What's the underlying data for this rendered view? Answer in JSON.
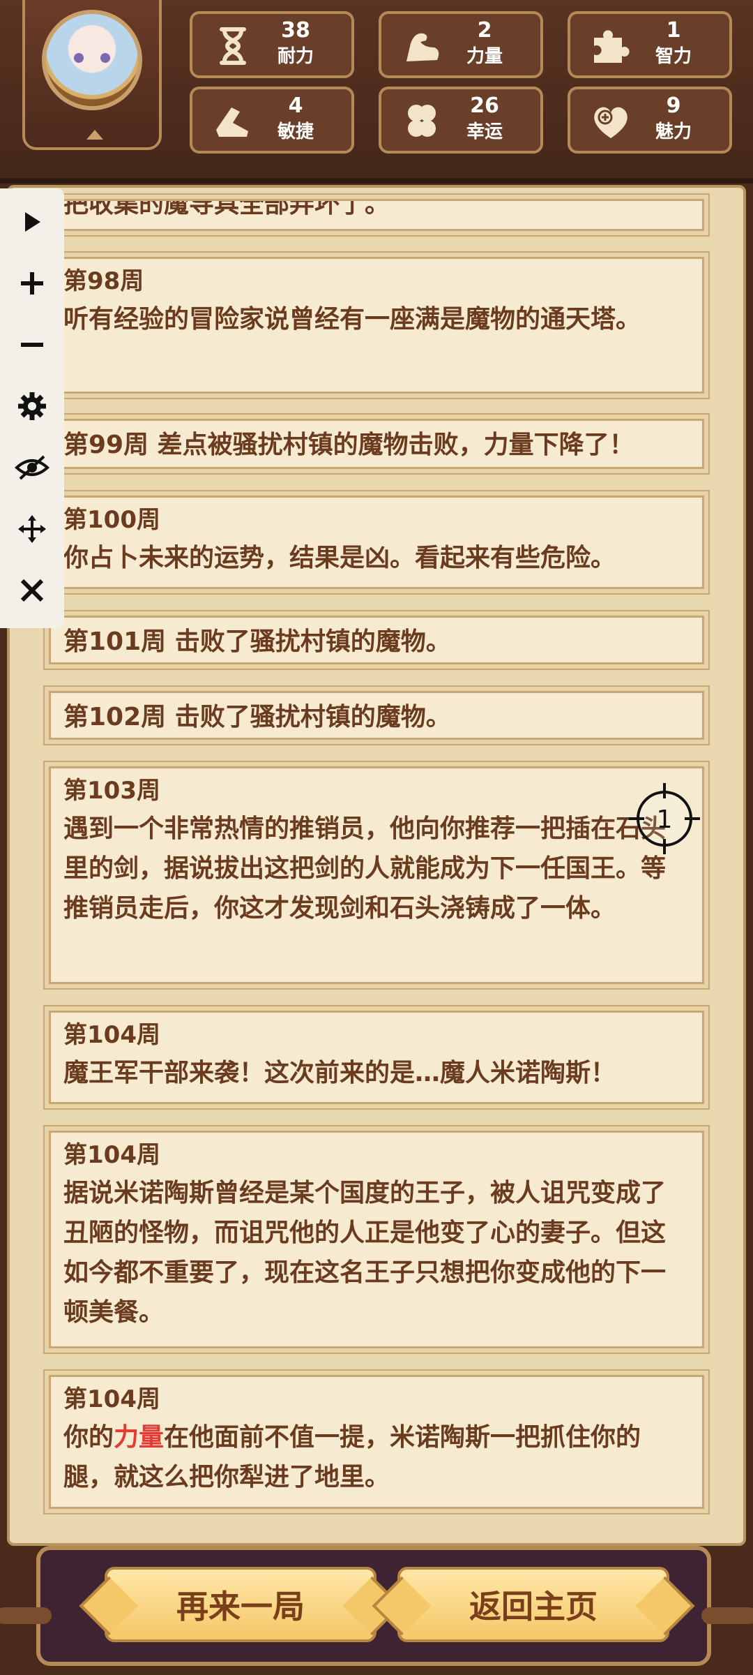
{
  "stats": [
    {
      "icon": "hourglass-icon",
      "value": "38",
      "label": "耐力"
    },
    {
      "icon": "muscle-arm-icon",
      "value": "2",
      "label": "力量"
    },
    {
      "icon": "puzzle-piece-icon",
      "value": "1",
      "label": "智力"
    },
    {
      "icon": "boot-icon",
      "value": "4",
      "label": "敏捷"
    },
    {
      "icon": "clover-icon",
      "value": "26",
      "label": "幸运"
    },
    {
      "icon": "heart-plus-icon",
      "value": "9",
      "label": "魅力"
    }
  ],
  "events": [
    {
      "text": "把收集的魔导具全部弄坏了。"
    },
    {
      "week": "第98周",
      "text": "听有经验的冒险家说曾经有一座满是魔物的通天塔。"
    },
    {
      "week": "第99周",
      "text": "差点被骚扰村镇的魔物击败，力量下降了！"
    },
    {
      "week": "第100周",
      "text": "你占卜未来的运势，结果是凶。看起来有些危险。"
    },
    {
      "week": "第101周",
      "text": "击败了骚扰村镇的魔物。"
    },
    {
      "week": "第102周",
      "text": "击败了骚扰村镇的魔物。"
    },
    {
      "week": "第103周",
      "text": "遇到一个非常热情的推销员，他向你推荐一把插在石头里的剑，据说拔出这把剑的人就能成为下一任国王。等推销员走后，你这才发现剑和石头浇铸成了一体。"
    },
    {
      "week": "第104周",
      "text": "魔王军干部来袭！这次前来的是…魔人米诺陶斯！"
    },
    {
      "week": "第104周",
      "text": "据说米诺陶斯曾经是某个国度的王子，被人诅咒变成了丑陋的怪物，而诅咒他的人正是他变了心的妻子。但这如今都不重要了，现在这名王子只想把你变成他的下一顿美餐。"
    },
    {
      "week": "第104周",
      "text_before": "你的",
      "highlight": "力量",
      "text_after": "在他面前不值一提，米诺陶斯一把抓住你的腿，就这么把你犁进了地里。"
    }
  ],
  "toolbar": [
    "play-icon",
    "plus-icon",
    "minus-icon",
    "gear-icon",
    "eye-off-icon",
    "move-icon",
    "close-icon"
  ],
  "target_label": "1",
  "buttons": {
    "restart": "再来一局",
    "home": "返回主页"
  },
  "colors": {
    "text": "#6a3b1e",
    "highlight": "#e43a36",
    "parchment": "#f6ebd0",
    "wood": "#4a2a1a"
  }
}
